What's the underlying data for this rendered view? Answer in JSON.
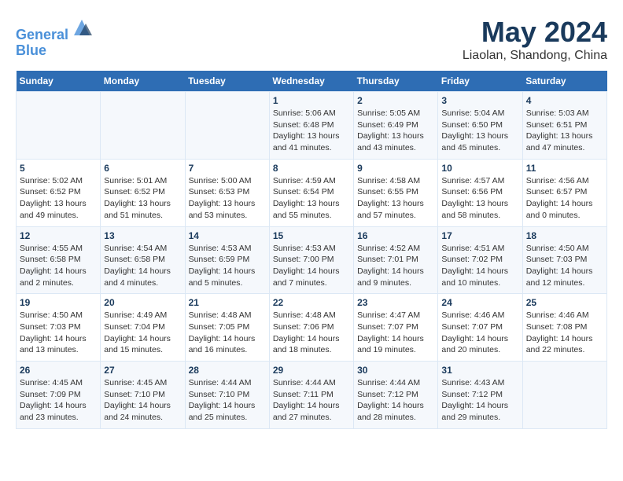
{
  "header": {
    "logo_line1": "General",
    "logo_line2": "Blue",
    "title": "May 2024",
    "subtitle": "Liaolan, Shandong, China"
  },
  "weekdays": [
    "Sunday",
    "Monday",
    "Tuesday",
    "Wednesday",
    "Thursday",
    "Friday",
    "Saturday"
  ],
  "weeks": [
    [
      {
        "day": "",
        "info": ""
      },
      {
        "day": "",
        "info": ""
      },
      {
        "day": "",
        "info": ""
      },
      {
        "day": "1",
        "info": "Sunrise: 5:06 AM\nSunset: 6:48 PM\nDaylight: 13 hours\nand 41 minutes."
      },
      {
        "day": "2",
        "info": "Sunrise: 5:05 AM\nSunset: 6:49 PM\nDaylight: 13 hours\nand 43 minutes."
      },
      {
        "day": "3",
        "info": "Sunrise: 5:04 AM\nSunset: 6:50 PM\nDaylight: 13 hours\nand 45 minutes."
      },
      {
        "day": "4",
        "info": "Sunrise: 5:03 AM\nSunset: 6:51 PM\nDaylight: 13 hours\nand 47 minutes."
      }
    ],
    [
      {
        "day": "5",
        "info": "Sunrise: 5:02 AM\nSunset: 6:52 PM\nDaylight: 13 hours\nand 49 minutes."
      },
      {
        "day": "6",
        "info": "Sunrise: 5:01 AM\nSunset: 6:52 PM\nDaylight: 13 hours\nand 51 minutes."
      },
      {
        "day": "7",
        "info": "Sunrise: 5:00 AM\nSunset: 6:53 PM\nDaylight: 13 hours\nand 53 minutes."
      },
      {
        "day": "8",
        "info": "Sunrise: 4:59 AM\nSunset: 6:54 PM\nDaylight: 13 hours\nand 55 minutes."
      },
      {
        "day": "9",
        "info": "Sunrise: 4:58 AM\nSunset: 6:55 PM\nDaylight: 13 hours\nand 57 minutes."
      },
      {
        "day": "10",
        "info": "Sunrise: 4:57 AM\nSunset: 6:56 PM\nDaylight: 13 hours\nand 58 minutes."
      },
      {
        "day": "11",
        "info": "Sunrise: 4:56 AM\nSunset: 6:57 PM\nDaylight: 14 hours\nand 0 minutes."
      }
    ],
    [
      {
        "day": "12",
        "info": "Sunrise: 4:55 AM\nSunset: 6:58 PM\nDaylight: 14 hours\nand 2 minutes."
      },
      {
        "day": "13",
        "info": "Sunrise: 4:54 AM\nSunset: 6:58 PM\nDaylight: 14 hours\nand 4 minutes."
      },
      {
        "day": "14",
        "info": "Sunrise: 4:53 AM\nSunset: 6:59 PM\nDaylight: 14 hours\nand 5 minutes."
      },
      {
        "day": "15",
        "info": "Sunrise: 4:53 AM\nSunset: 7:00 PM\nDaylight: 14 hours\nand 7 minutes."
      },
      {
        "day": "16",
        "info": "Sunrise: 4:52 AM\nSunset: 7:01 PM\nDaylight: 14 hours\nand 9 minutes."
      },
      {
        "day": "17",
        "info": "Sunrise: 4:51 AM\nSunset: 7:02 PM\nDaylight: 14 hours\nand 10 minutes."
      },
      {
        "day": "18",
        "info": "Sunrise: 4:50 AM\nSunset: 7:03 PM\nDaylight: 14 hours\nand 12 minutes."
      }
    ],
    [
      {
        "day": "19",
        "info": "Sunrise: 4:50 AM\nSunset: 7:03 PM\nDaylight: 14 hours\nand 13 minutes."
      },
      {
        "day": "20",
        "info": "Sunrise: 4:49 AM\nSunset: 7:04 PM\nDaylight: 14 hours\nand 15 minutes."
      },
      {
        "day": "21",
        "info": "Sunrise: 4:48 AM\nSunset: 7:05 PM\nDaylight: 14 hours\nand 16 minutes."
      },
      {
        "day": "22",
        "info": "Sunrise: 4:48 AM\nSunset: 7:06 PM\nDaylight: 14 hours\nand 18 minutes."
      },
      {
        "day": "23",
        "info": "Sunrise: 4:47 AM\nSunset: 7:07 PM\nDaylight: 14 hours\nand 19 minutes."
      },
      {
        "day": "24",
        "info": "Sunrise: 4:46 AM\nSunset: 7:07 PM\nDaylight: 14 hours\nand 20 minutes."
      },
      {
        "day": "25",
        "info": "Sunrise: 4:46 AM\nSunset: 7:08 PM\nDaylight: 14 hours\nand 22 minutes."
      }
    ],
    [
      {
        "day": "26",
        "info": "Sunrise: 4:45 AM\nSunset: 7:09 PM\nDaylight: 14 hours\nand 23 minutes."
      },
      {
        "day": "27",
        "info": "Sunrise: 4:45 AM\nSunset: 7:10 PM\nDaylight: 14 hours\nand 24 minutes."
      },
      {
        "day": "28",
        "info": "Sunrise: 4:44 AM\nSunset: 7:10 PM\nDaylight: 14 hours\nand 25 minutes."
      },
      {
        "day": "29",
        "info": "Sunrise: 4:44 AM\nSunset: 7:11 PM\nDaylight: 14 hours\nand 27 minutes."
      },
      {
        "day": "30",
        "info": "Sunrise: 4:44 AM\nSunset: 7:12 PM\nDaylight: 14 hours\nand 28 minutes."
      },
      {
        "day": "31",
        "info": "Sunrise: 4:43 AM\nSunset: 7:12 PM\nDaylight: 14 hours\nand 29 minutes."
      },
      {
        "day": "",
        "info": ""
      }
    ]
  ]
}
